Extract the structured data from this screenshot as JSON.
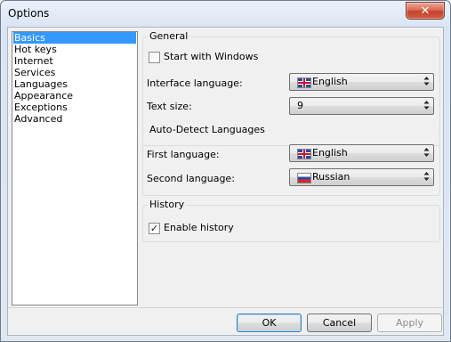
{
  "window": {
    "title": "Options"
  },
  "nav": {
    "items": [
      "Basics",
      "Hot keys",
      "Internet",
      "Services",
      "Languages",
      "Appearance",
      "Exceptions",
      "Advanced"
    ],
    "selected": "Basics"
  },
  "general": {
    "title": "General",
    "start_with_windows": {
      "label": "Start with Windows",
      "checked": false
    },
    "interface_language": {
      "label": "Interface language:",
      "value": "English",
      "flag": "uk-flag-icon"
    },
    "text_size": {
      "label": "Text size:",
      "value": "9"
    }
  },
  "auto_detect": {
    "title": "Auto-Detect Languages",
    "first_language": {
      "label": "First language:",
      "value": "English",
      "flag": "uk-flag-icon"
    },
    "second_language": {
      "label": "Second language:",
      "value": "Russian",
      "flag": "russia-flag-icon"
    }
  },
  "history": {
    "title": "History",
    "enable_history": {
      "label": "Enable history",
      "checked": true
    }
  },
  "buttons": {
    "ok": "OK",
    "cancel": "Cancel",
    "apply": "Apply"
  },
  "colors": {
    "selection": "#3399ff",
    "client_background": "#f0f0f0",
    "close_button": "#c2432c"
  }
}
